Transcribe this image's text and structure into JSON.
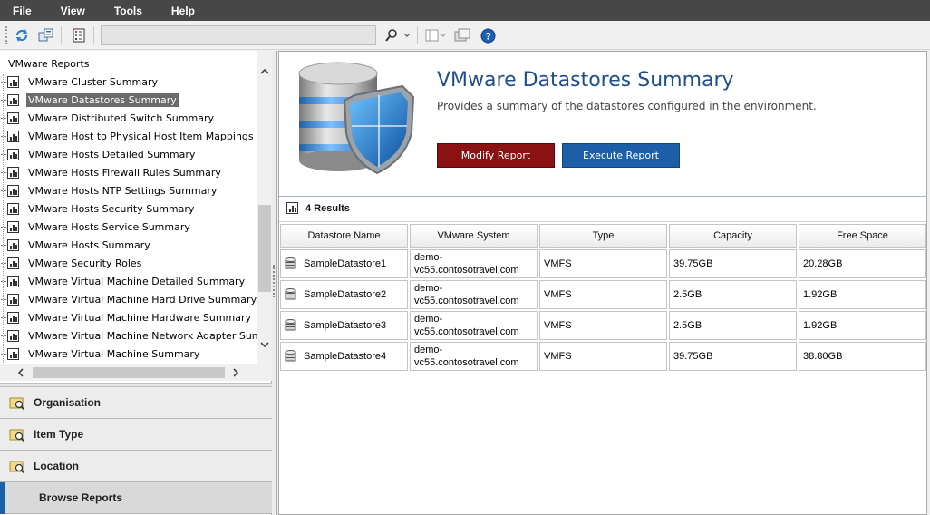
{
  "menu": [
    "File",
    "View",
    "Tools",
    "Help"
  ],
  "toolbar": {
    "search_value": "",
    "icons": [
      "refresh-icon",
      "copy-icon",
      "report-icon",
      "search-icon",
      "chevron-down-icon",
      "columns-icon",
      "folder-icon",
      "help-icon"
    ]
  },
  "tree": {
    "root": "VMware Reports",
    "selected_index": 1,
    "items": [
      "VMware Cluster Summary",
      "VMware Datastores Summary",
      "VMware Distributed Switch Summary",
      "VMware Host to Physical Host Item Mappings",
      "VMware Hosts Detailed Summary",
      "VMware Hosts Firewall Rules Summary",
      "VMware Hosts NTP Settings Summary",
      "VMware Hosts Security Summary",
      "VMware Hosts Service Summary",
      "VMware Hosts Summary",
      "VMware Security Roles",
      "VMware Virtual Machine Detailed Summary",
      "VMware Virtual Machine Hard Drive Summary",
      "VMware Virtual Machine Hardware Summary",
      "VMware Virtual Machine Network Adapter Summary",
      "VMware Virtual Machine Summary"
    ]
  },
  "nav": {
    "organisation": "Organisation",
    "item_type": "Item Type",
    "location": "Location",
    "browse_reports": "Browse Reports",
    "active": "browse_reports"
  },
  "report": {
    "title": "VMware Datastores Summary",
    "description": "Provides a summary of the datastores configured in the environment.",
    "modify_label": "Modify Report",
    "execute_label": "Execute Report",
    "results_label": "4 Results"
  },
  "table": {
    "headers": [
      "Datastore Name",
      "VMware System",
      "Type",
      "Capacity",
      "Free Space"
    ],
    "rows": [
      [
        "SampleDatastore1",
        "demo-\nvc55.contosotravel.com",
        "VMFS",
        "39.75GB",
        "20.28GB"
      ],
      [
        "SampleDatastore2",
        "demo-\nvc55.contosotravel.com",
        "VMFS",
        "2.5GB",
        "1.92GB"
      ],
      [
        "SampleDatastore3",
        "demo-\nvc55.contosotravel.com",
        "VMFS",
        "2.5GB",
        "1.92GB"
      ],
      [
        "SampleDatastore4",
        "demo-\nvc55.contosotravel.com",
        "VMFS",
        "39.75GB",
        "38.80GB"
      ]
    ]
  },
  "colors": {
    "menubar": "#474747",
    "modify_button": "#8b1212",
    "execute_button": "#1c5ea8",
    "title": "#1f4e8c",
    "selection": "#6b6b6b"
  }
}
